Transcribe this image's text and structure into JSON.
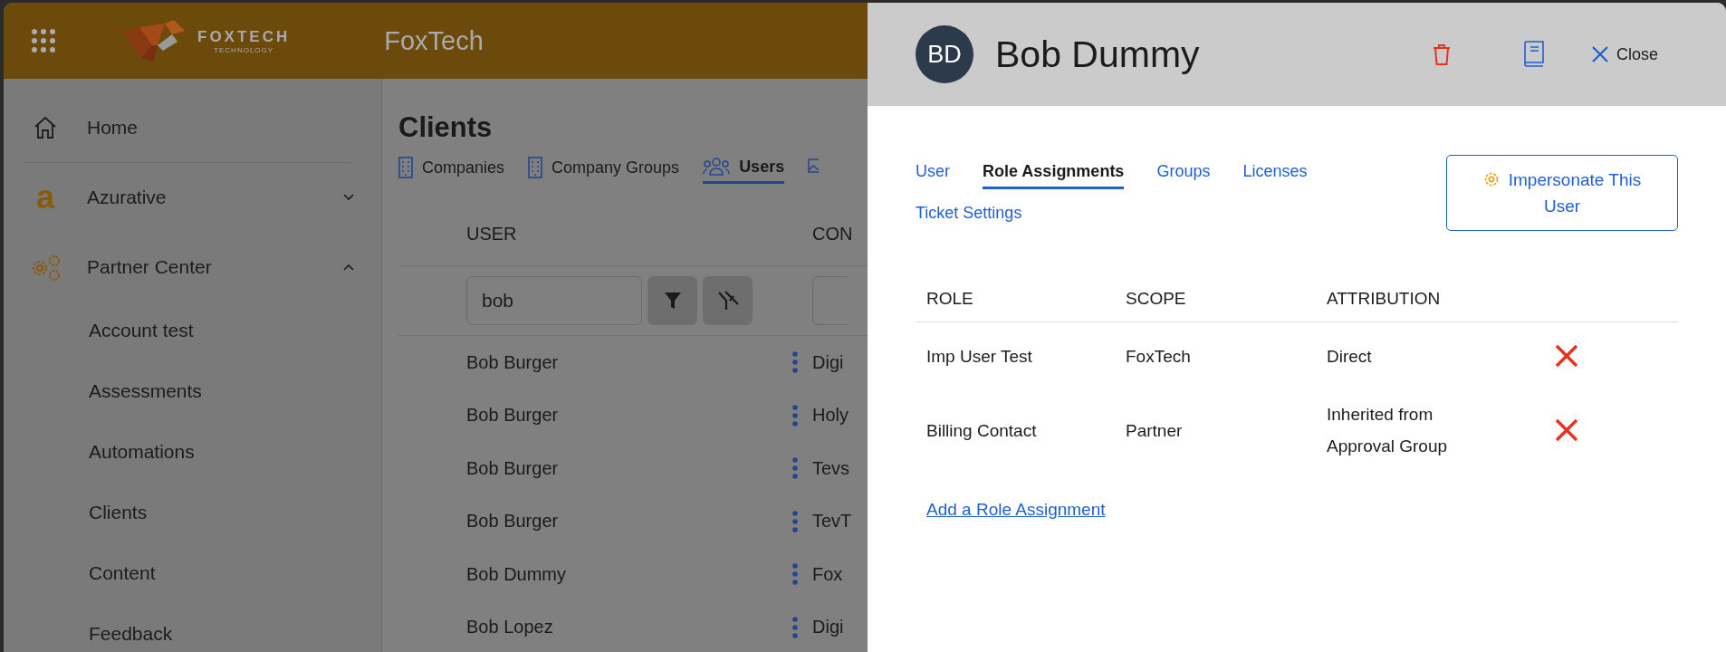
{
  "app": {
    "title": "FoxTech",
    "logo": {
      "name": "FOXTECH",
      "tagline": "TECHNOLOGY"
    }
  },
  "sidebar": {
    "items": [
      {
        "kind": "link",
        "label": "Home"
      },
      {
        "kind": "group",
        "label": "Azurative",
        "icon_text": "a",
        "expanded": false
      },
      {
        "kind": "group",
        "label": "Partner Center",
        "expanded": true,
        "children": [
          {
            "label": "Account test"
          },
          {
            "label": "Assessments"
          },
          {
            "label": "Automations"
          },
          {
            "label": "Clients"
          },
          {
            "label": "Content"
          },
          {
            "label": "Feedback"
          }
        ]
      }
    ]
  },
  "page": {
    "title": "Clients",
    "tabs": [
      {
        "label": "Companies",
        "selected": false
      },
      {
        "label": "Company Groups",
        "selected": false
      },
      {
        "label": "Users",
        "selected": true
      }
    ],
    "table": {
      "columns": [
        "USER",
        "CON"
      ],
      "filter": {
        "value": "bob"
      },
      "rows": [
        {
          "user": "Bob Burger",
          "column_2": "Digi"
        },
        {
          "user": "Bob Burger",
          "column_2": "Holy"
        },
        {
          "user": "Bob Burger",
          "column_2": "Tevs"
        },
        {
          "user": "Bob Burger",
          "column_2": "TevT"
        },
        {
          "user": "Bob Dummy",
          "column_2": "Fox"
        },
        {
          "user": "Bob Lopez",
          "column_2": "Digi"
        }
      ]
    }
  },
  "drawer": {
    "avatar": "BD",
    "name": "Bob Dummy",
    "close": "Close",
    "tabs": [
      {
        "label": "User",
        "selected": false
      },
      {
        "label": "Role Assignments",
        "selected": true
      },
      {
        "label": "Groups",
        "selected": false
      },
      {
        "label": "Licenses",
        "selected": false
      },
      {
        "label": "Ticket Settings",
        "selected": false
      }
    ],
    "impersonate": "Impersonate This User",
    "table": {
      "columns": [
        "ROLE",
        "SCOPE",
        "ATTRIBUTION"
      ],
      "rows": [
        {
          "role": "Imp User Test",
          "scope": "FoxTech",
          "attribution": "Direct"
        },
        {
          "role": "Billing Contact",
          "scope": "Partner",
          "attribution": "Inherited from Approval Group"
        }
      ]
    },
    "add_link": "Add a Role Assignment"
  }
}
